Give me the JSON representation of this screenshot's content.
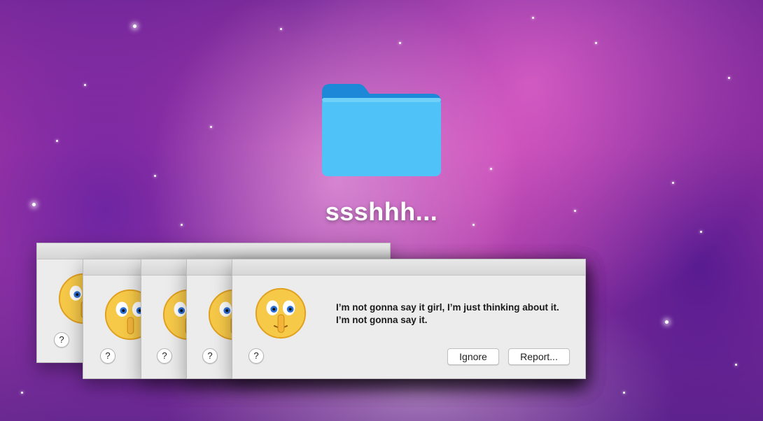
{
  "desktop": {
    "folder_label": "ssshhh..."
  },
  "dialog": {
    "message_line1": "I’m not gonna say it girl, I’m just thinking about it.",
    "message_line2": "I’m not gonna say it.",
    "ignore_label": "Ignore",
    "report_label": "Report...",
    "help_label": "?"
  },
  "colors": {
    "folder": "#4fc3f7",
    "folder_tab": "#1e88d8",
    "dialog_bg": "#ececec"
  },
  "icons": {
    "emoji": "shushing-face-icon",
    "folder": "folder-icon"
  }
}
